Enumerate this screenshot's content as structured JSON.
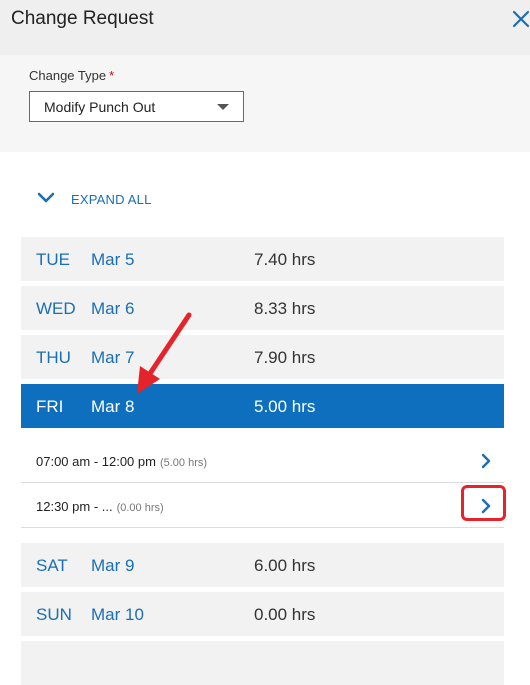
{
  "header": {
    "title": "Change Request"
  },
  "form": {
    "change_type_label": "Change Type",
    "required_mark": "*",
    "change_type_value": "Modify Punch Out"
  },
  "expand_all_label": "EXPAND ALL",
  "days": [
    {
      "dow": "TUE",
      "date": "Mar 5",
      "hours": "7.40 hrs"
    },
    {
      "dow": "WED",
      "date": "Mar 6",
      "hours": "8.33 hrs"
    },
    {
      "dow": "THU",
      "date": "Mar 7",
      "hours": "7.90 hrs"
    },
    {
      "dow": "FRI",
      "date": "Mar 8",
      "hours": "5.00 hrs"
    },
    {
      "dow": "SAT",
      "date": "Mar 9",
      "hours": "6.00 hrs"
    },
    {
      "dow": "SUN",
      "date": "Mar 10",
      "hours": "0.00 hrs"
    }
  ],
  "punches": [
    {
      "time": "07:00 am - 12:00 pm",
      "duration": "(5.00 hrs)"
    },
    {
      "time": "12:30 pm - ...",
      "duration": "(0.00 hrs)"
    }
  ],
  "colors": {
    "accent": "#0d6fbd",
    "link": "#1a6fb3",
    "annotation": "#e4242a"
  },
  "icons": {
    "close": "close-icon",
    "expand": "chevron-down-icon",
    "punch": "chevron-right-icon",
    "select": "caret-down-icon"
  }
}
